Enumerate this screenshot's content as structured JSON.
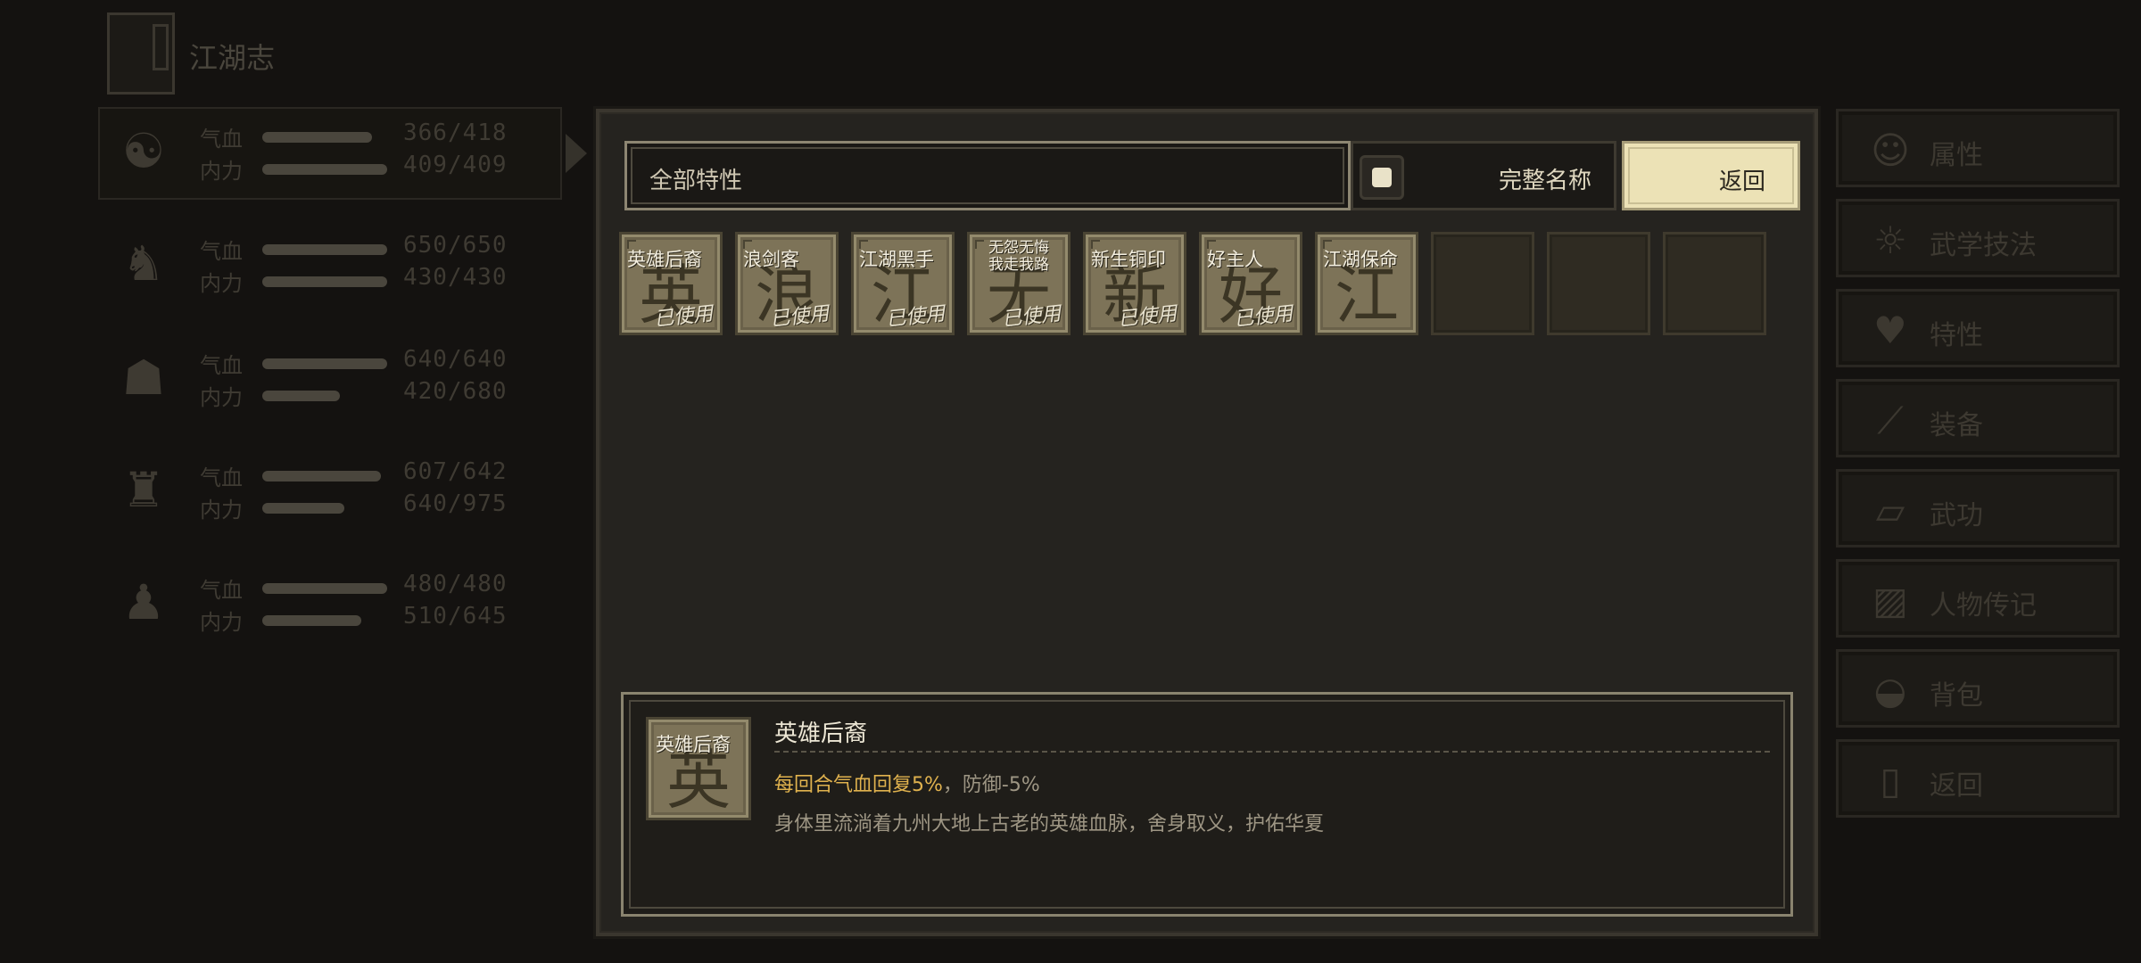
{
  "background": {
    "book_title": "江湖志",
    "party": [
      {
        "hp_label": "气血",
        "mp_label": "内力",
        "hp": "366/418",
        "mp": "409/409",
        "hp_frac": 0.88,
        "mp_frac": 1.0
      },
      {
        "hp_label": "气血",
        "mp_label": "内力",
        "hp": "650/650",
        "mp": "430/430",
        "hp_frac": 1.0,
        "mp_frac": 1.0
      },
      {
        "hp_label": "气血",
        "mp_label": "内力",
        "hp": "640/640",
        "mp": "420/680",
        "hp_frac": 1.0,
        "mp_frac": 0.62
      },
      {
        "hp_label": "气血",
        "mp_label": "内力",
        "hp": "607/642",
        "mp": "640/975",
        "hp_frac": 0.95,
        "mp_frac": 0.66
      },
      {
        "hp_label": "气血",
        "mp_label": "内力",
        "hp": "480/480",
        "mp": "510/645",
        "hp_frac": 1.0,
        "mp_frac": 0.79
      }
    ],
    "menu": [
      {
        "label": "属性",
        "icon": "person-icon"
      },
      {
        "label": "武学技法",
        "icon": "lightbulb-person-icon"
      },
      {
        "label": "特性",
        "icon": "heart-person-icon"
      },
      {
        "label": "装备",
        "icon": "sword-icon"
      },
      {
        "label": "武功",
        "icon": "scroll-icon"
      },
      {
        "label": "人物传记",
        "icon": "book-icon"
      },
      {
        "label": "背包",
        "icon": "bag-icon"
      },
      {
        "label": "返回",
        "icon": "door-icon"
      }
    ]
  },
  "filter": {
    "label": "全部特性"
  },
  "toggle": {
    "label": "完整名称"
  },
  "back_button": {
    "label": "返回"
  },
  "traits": [
    {
      "name": "英雄后裔",
      "glyph": "英",
      "status": "已使用"
    },
    {
      "name": "浪剑客",
      "glyph": "浪",
      "status": "已使用"
    },
    {
      "name": "江湖黑手",
      "glyph": "江",
      "status": "已使用"
    },
    {
      "name": "无怨无悔\n我走我路",
      "glyph": "无",
      "status": "已使用"
    },
    {
      "name": "新生铜印",
      "glyph": "新",
      "status": "已使用"
    },
    {
      "name": "好主人",
      "glyph": "好",
      "status": "已使用"
    },
    {
      "name": "江湖保命",
      "glyph": "江",
      "status": ""
    }
  ],
  "detail": {
    "icon_name": "英雄后裔",
    "icon_glyph": "英",
    "title": "英雄后裔",
    "effect_good": "每回合气血回复5%",
    "effect_rest": "，防御-5%",
    "description": "身体里流淌着九州大地上古老的英雄血脉，舍身取义，护佑华夏"
  },
  "colors": {
    "panel": "#25231f",
    "slot_filled": "#7d7358",
    "highlight": "#e0b24e",
    "button": "#ece2b6"
  }
}
